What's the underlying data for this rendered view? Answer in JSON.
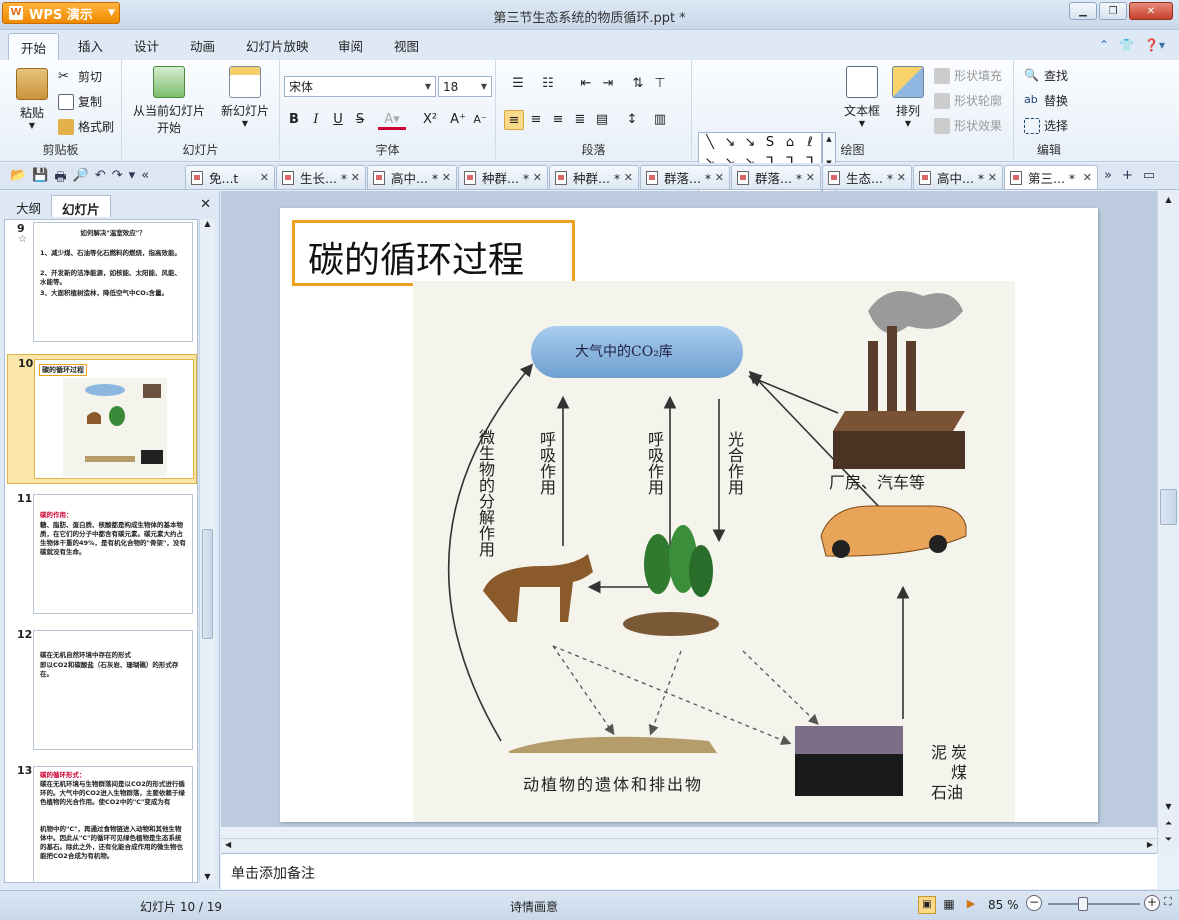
{
  "app": {
    "name": "WPS 演示",
    "window_title": "第三节生态系统的物质循环.ppt *"
  },
  "ribbon_tabs": [
    "开始",
    "插入",
    "设计",
    "动画",
    "幻灯片放映",
    "审阅",
    "视图"
  ],
  "ribbon": {
    "clipboard": {
      "paste": "粘贴",
      "cut": "剪切",
      "copy": "复制",
      "format_painter": "格式刷",
      "label": "剪贴板"
    },
    "slides": {
      "from_current": "从当前幻灯片",
      "start": "开始",
      "new_slide": "新幻灯片",
      "label": "幻灯片"
    },
    "font": {
      "family": "宋体",
      "size": "18",
      "label": "字体",
      "bold": "B",
      "italic": "I",
      "underline": "U",
      "strike": "S"
    },
    "paragraph": {
      "label": "段落"
    },
    "drawing": {
      "textbox": "文本框",
      "arrange": "排列",
      "shape_fill": "形状填充",
      "shape_outline": "形状轮廓",
      "shape_effect": "形状效果",
      "label": "绘图"
    },
    "editing": {
      "find": "查找",
      "replace": "替换",
      "select": "选择",
      "label": "编辑"
    }
  },
  "doc_tabs": [
    "免...t",
    "生长... *",
    "高中... *",
    "种群... *",
    "种群... *",
    "群落... *",
    "群落... *",
    "生态... *",
    "高中... *",
    "第三... *"
  ],
  "panel": {
    "tab_outline": "大纲",
    "tab_slides": "幻灯片"
  },
  "thumbnails": [
    {
      "num": "9",
      "lines": [
        "如何解决\"温室效应\"？",
        "1、减少煤、石油等化石燃料的燃烧，指高效能。",
        "2、开发新的洁净能源，如核能、太阳能、风能、水能等。",
        "3、大面积植树造林，降低空气中CO₂含量。"
      ]
    },
    {
      "num": "10",
      "title": "碳的循环过程"
    },
    {
      "num": "11",
      "lines": [
        "碳的作用：",
        "糖、脂肪、蛋白质、核酸都是构成生物体的基本物质，在它们的分子中都含有碳元素。碳元素大约占生物体干重的49%，是有机化合物的\"骨架\"，没有碳就没有生命。"
      ]
    },
    {
      "num": "12",
      "lines": [
        "碳在无机自然环境中存在的形式",
        "即以CO2和碳酸盐（石灰岩、珊瑚礁）的形式存在。"
      ]
    },
    {
      "num": "13",
      "lines": [
        "碳的循环形式：",
        "碳在无机环境与生物群落间是以CO2的形式进行循环的。大气中的CO2进入生物群落，主要依赖于绿色植物的光合作用。使CO2中的\"C\"变成为有",
        "机物中的\"C\"，再通过食物链进入动物和其他生物体中。因此从\"C\"的循环可见绿色植物是生态系统的基石。除此之外，还有化能合成作用的微生物也能把CO2合成为有机物。"
      ]
    }
  ],
  "slide": {
    "title": "碳的循环过程",
    "figure": {
      "co2_pool": "大气中的CO₂库",
      "decomposition": "微生物的分解作用",
      "respiration1": "呼吸作用",
      "respiration2": "呼吸作用",
      "photosynthesis": "光合作用",
      "factory": "厂房、汽车等",
      "remains": "动植物的遗体和排出物",
      "fuels": [
        "泥",
        "炭",
        "煤",
        "石油"
      ]
    }
  },
  "notes_placeholder": "单击添加备注",
  "status": {
    "slide_pos": "幻灯片 10 / 19",
    "theme": "诗情画意",
    "zoom": "85 %"
  },
  "colors": {
    "accent": "#f0a020",
    "selected_thumb": "#fbe6a8"
  }
}
